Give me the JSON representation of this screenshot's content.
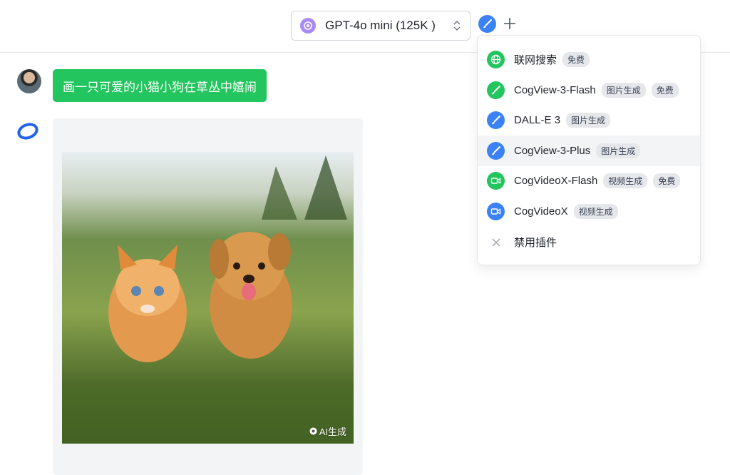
{
  "header": {
    "model_name": "GPT-4o mini (125K )"
  },
  "chat": {
    "user_message": "画一只可爱的小猫小狗在草丛中嬉闹",
    "image_badge": "AI生成"
  },
  "plugin_menu": {
    "items": [
      {
        "label": "联网搜索",
        "icon": "globe-icon",
        "color": "#22c55e",
        "tags": [
          "免费"
        ]
      },
      {
        "label": "CogView-3-Flash",
        "icon": "brush-icon",
        "color": "#22c55e",
        "tags": [
          "图片生成",
          "免费"
        ]
      },
      {
        "label": "DALL-E 3",
        "icon": "brush-icon",
        "color": "#3b82f6",
        "tags": [
          "图片生成"
        ]
      },
      {
        "label": "CogView-3-Plus",
        "icon": "brush-icon",
        "color": "#3b82f6",
        "tags": [
          "图片生成"
        ],
        "selected": true
      },
      {
        "label": "CogVideoX-Flash",
        "icon": "video-icon",
        "color": "#22c55e",
        "tags": [
          "视频生成",
          "免费"
        ]
      },
      {
        "label": "CogVideoX",
        "icon": "video-icon",
        "color": "#3b82f6",
        "tags": [
          "视频生成"
        ]
      },
      {
        "label": "禁用插件",
        "icon": "close-icon",
        "color": "#9ca3af",
        "tags": []
      }
    ]
  },
  "colors": {
    "accent_green": "#22c55e",
    "accent_blue": "#3b82f6"
  }
}
